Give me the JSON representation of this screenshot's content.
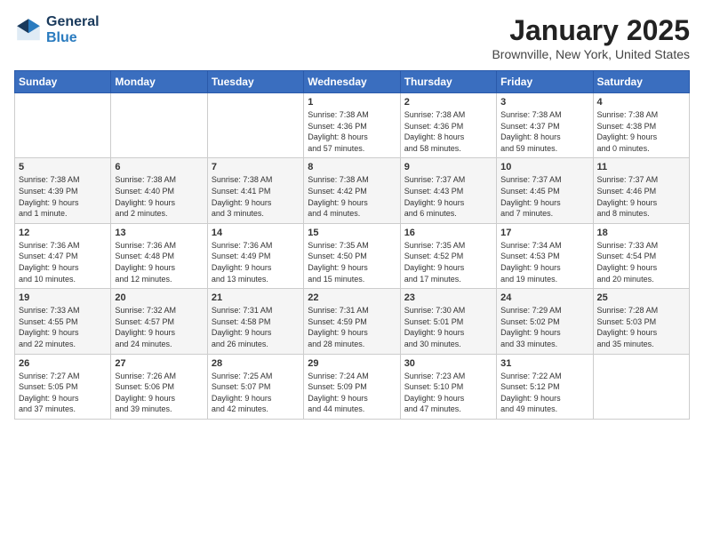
{
  "header": {
    "logo_line1": "General",
    "logo_line2": "Blue",
    "month": "January 2025",
    "location": "Brownville, New York, United States"
  },
  "weekdays": [
    "Sunday",
    "Monday",
    "Tuesday",
    "Wednesday",
    "Thursday",
    "Friday",
    "Saturday"
  ],
  "weeks": [
    [
      {
        "day": "",
        "info": ""
      },
      {
        "day": "",
        "info": ""
      },
      {
        "day": "",
        "info": ""
      },
      {
        "day": "1",
        "info": "Sunrise: 7:38 AM\nSunset: 4:36 PM\nDaylight: 8 hours\nand 57 minutes."
      },
      {
        "day": "2",
        "info": "Sunrise: 7:38 AM\nSunset: 4:36 PM\nDaylight: 8 hours\nand 58 minutes."
      },
      {
        "day": "3",
        "info": "Sunrise: 7:38 AM\nSunset: 4:37 PM\nDaylight: 8 hours\nand 59 minutes."
      },
      {
        "day": "4",
        "info": "Sunrise: 7:38 AM\nSunset: 4:38 PM\nDaylight: 9 hours\nand 0 minutes."
      }
    ],
    [
      {
        "day": "5",
        "info": "Sunrise: 7:38 AM\nSunset: 4:39 PM\nDaylight: 9 hours\nand 1 minute."
      },
      {
        "day": "6",
        "info": "Sunrise: 7:38 AM\nSunset: 4:40 PM\nDaylight: 9 hours\nand 2 minutes."
      },
      {
        "day": "7",
        "info": "Sunrise: 7:38 AM\nSunset: 4:41 PM\nDaylight: 9 hours\nand 3 minutes."
      },
      {
        "day": "8",
        "info": "Sunrise: 7:38 AM\nSunset: 4:42 PM\nDaylight: 9 hours\nand 4 minutes."
      },
      {
        "day": "9",
        "info": "Sunrise: 7:37 AM\nSunset: 4:43 PM\nDaylight: 9 hours\nand 6 minutes."
      },
      {
        "day": "10",
        "info": "Sunrise: 7:37 AM\nSunset: 4:45 PM\nDaylight: 9 hours\nand 7 minutes."
      },
      {
        "day": "11",
        "info": "Sunrise: 7:37 AM\nSunset: 4:46 PM\nDaylight: 9 hours\nand 8 minutes."
      }
    ],
    [
      {
        "day": "12",
        "info": "Sunrise: 7:36 AM\nSunset: 4:47 PM\nDaylight: 9 hours\nand 10 minutes."
      },
      {
        "day": "13",
        "info": "Sunrise: 7:36 AM\nSunset: 4:48 PM\nDaylight: 9 hours\nand 12 minutes."
      },
      {
        "day": "14",
        "info": "Sunrise: 7:36 AM\nSunset: 4:49 PM\nDaylight: 9 hours\nand 13 minutes."
      },
      {
        "day": "15",
        "info": "Sunrise: 7:35 AM\nSunset: 4:50 PM\nDaylight: 9 hours\nand 15 minutes."
      },
      {
        "day": "16",
        "info": "Sunrise: 7:35 AM\nSunset: 4:52 PM\nDaylight: 9 hours\nand 17 minutes."
      },
      {
        "day": "17",
        "info": "Sunrise: 7:34 AM\nSunset: 4:53 PM\nDaylight: 9 hours\nand 19 minutes."
      },
      {
        "day": "18",
        "info": "Sunrise: 7:33 AM\nSunset: 4:54 PM\nDaylight: 9 hours\nand 20 minutes."
      }
    ],
    [
      {
        "day": "19",
        "info": "Sunrise: 7:33 AM\nSunset: 4:55 PM\nDaylight: 9 hours\nand 22 minutes."
      },
      {
        "day": "20",
        "info": "Sunrise: 7:32 AM\nSunset: 4:57 PM\nDaylight: 9 hours\nand 24 minutes."
      },
      {
        "day": "21",
        "info": "Sunrise: 7:31 AM\nSunset: 4:58 PM\nDaylight: 9 hours\nand 26 minutes."
      },
      {
        "day": "22",
        "info": "Sunrise: 7:31 AM\nSunset: 4:59 PM\nDaylight: 9 hours\nand 28 minutes."
      },
      {
        "day": "23",
        "info": "Sunrise: 7:30 AM\nSunset: 5:01 PM\nDaylight: 9 hours\nand 30 minutes."
      },
      {
        "day": "24",
        "info": "Sunrise: 7:29 AM\nSunset: 5:02 PM\nDaylight: 9 hours\nand 33 minutes."
      },
      {
        "day": "25",
        "info": "Sunrise: 7:28 AM\nSunset: 5:03 PM\nDaylight: 9 hours\nand 35 minutes."
      }
    ],
    [
      {
        "day": "26",
        "info": "Sunrise: 7:27 AM\nSunset: 5:05 PM\nDaylight: 9 hours\nand 37 minutes."
      },
      {
        "day": "27",
        "info": "Sunrise: 7:26 AM\nSunset: 5:06 PM\nDaylight: 9 hours\nand 39 minutes."
      },
      {
        "day": "28",
        "info": "Sunrise: 7:25 AM\nSunset: 5:07 PM\nDaylight: 9 hours\nand 42 minutes."
      },
      {
        "day": "29",
        "info": "Sunrise: 7:24 AM\nSunset: 5:09 PM\nDaylight: 9 hours\nand 44 minutes."
      },
      {
        "day": "30",
        "info": "Sunrise: 7:23 AM\nSunset: 5:10 PM\nDaylight: 9 hours\nand 47 minutes."
      },
      {
        "day": "31",
        "info": "Sunrise: 7:22 AM\nSunset: 5:12 PM\nDaylight: 9 hours\nand 49 minutes."
      },
      {
        "day": "",
        "info": ""
      }
    ]
  ]
}
